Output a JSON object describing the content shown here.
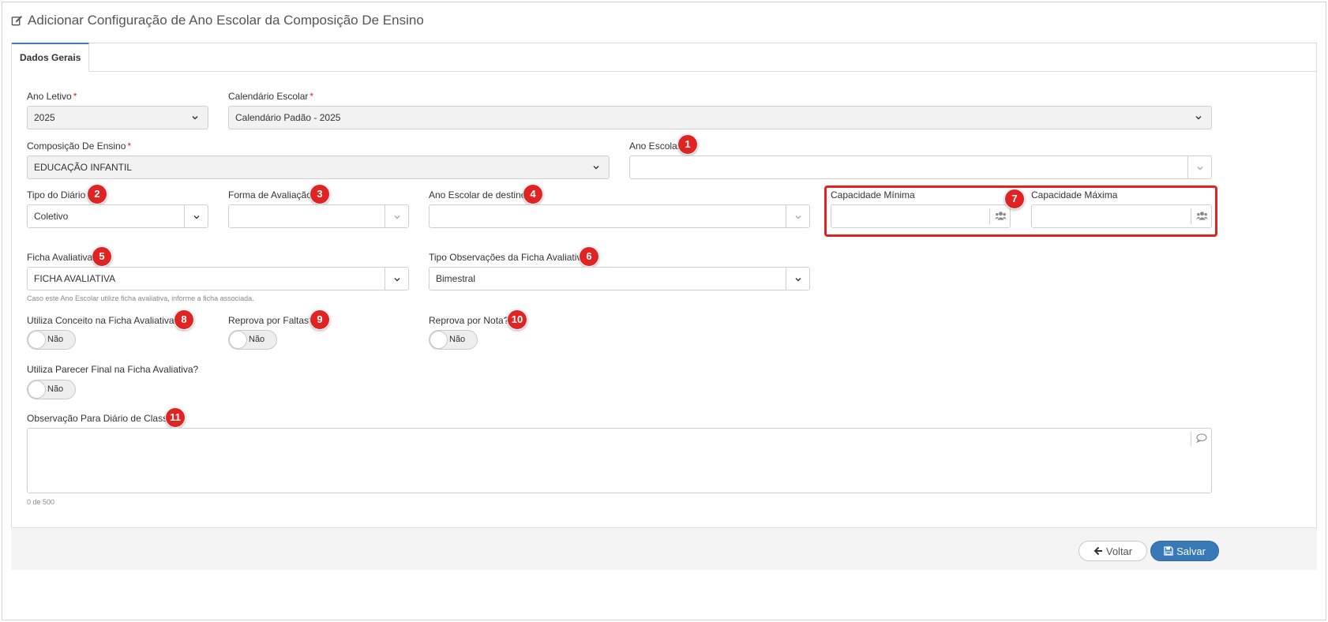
{
  "page": {
    "title": "Adicionar Configuração de Ano Escolar da Composição De Ensino"
  },
  "tabs": [
    {
      "label": "Dados Gerais"
    }
  ],
  "form": {
    "ano_letivo": {
      "label": "Ano Letivo",
      "required": "*",
      "value": "2025"
    },
    "calendario_escolar": {
      "label": "Calendário Escolar",
      "required": "*",
      "value": "Calendário Padão - 2025"
    },
    "composicao_ensino": {
      "label": "Composição De Ensino",
      "required": "*",
      "value": "EDUCAÇÃO INFANTIL"
    },
    "ano_escolar": {
      "label": "Ano Escolar",
      "value": ""
    },
    "tipo_diario": {
      "label": "Tipo do Diário",
      "value": "Coletivo"
    },
    "forma_avaliacao": {
      "label": "Forma de Avaliação",
      "value": ""
    },
    "ano_escolar_destino": {
      "label": "Ano Escolar de destino",
      "value": ""
    },
    "capacidade_minima": {
      "label": "Capacidade Mínima",
      "value": ""
    },
    "capacidade_maxima": {
      "label": "Capacidade Máxima",
      "value": ""
    },
    "ficha_avaliativa": {
      "label": "Ficha Avaliativa",
      "value": "FICHA AVALIATIVA",
      "help": "Caso este Ano Escolar utilize ficha avaliativa, informe a ficha associada."
    },
    "tipo_observacoes": {
      "label": "Tipo Observações da Ficha Avaliativa",
      "value": "Bimestral"
    },
    "utiliza_conceito": {
      "label": "Utiliza Conceito na Ficha Avaliativa?",
      "value": "Não"
    },
    "reprova_faltas": {
      "label": "Reprova por Faltas?",
      "value": "Não"
    },
    "reprova_nota": {
      "label": "Reprova por Nota?",
      "value": "Não"
    },
    "utiliza_parecer": {
      "label": "Utiliza Parecer Final na Ficha Avaliativa?",
      "value": "Não"
    },
    "observacao_diario": {
      "label": "Observação Para Diário de Classe",
      "value": "",
      "counter": "0 de 500"
    }
  },
  "annotations": [
    "1",
    "2",
    "3",
    "4",
    "5",
    "6",
    "7",
    "8",
    "9",
    "10",
    "11"
  ],
  "footer": {
    "back_label": "Voltar",
    "save_label": "Salvar"
  },
  "colors": {
    "accent": "#3a79b8",
    "required": "#d9251d",
    "annotation": "#e02424"
  },
  "icons": {
    "title": "edit-icon",
    "capacity": "users-icon",
    "textarea": "comment-icon",
    "back": "arrow-left-icon",
    "save": "floppy-disk-icon",
    "dropdown": "chevron-down-icon"
  }
}
